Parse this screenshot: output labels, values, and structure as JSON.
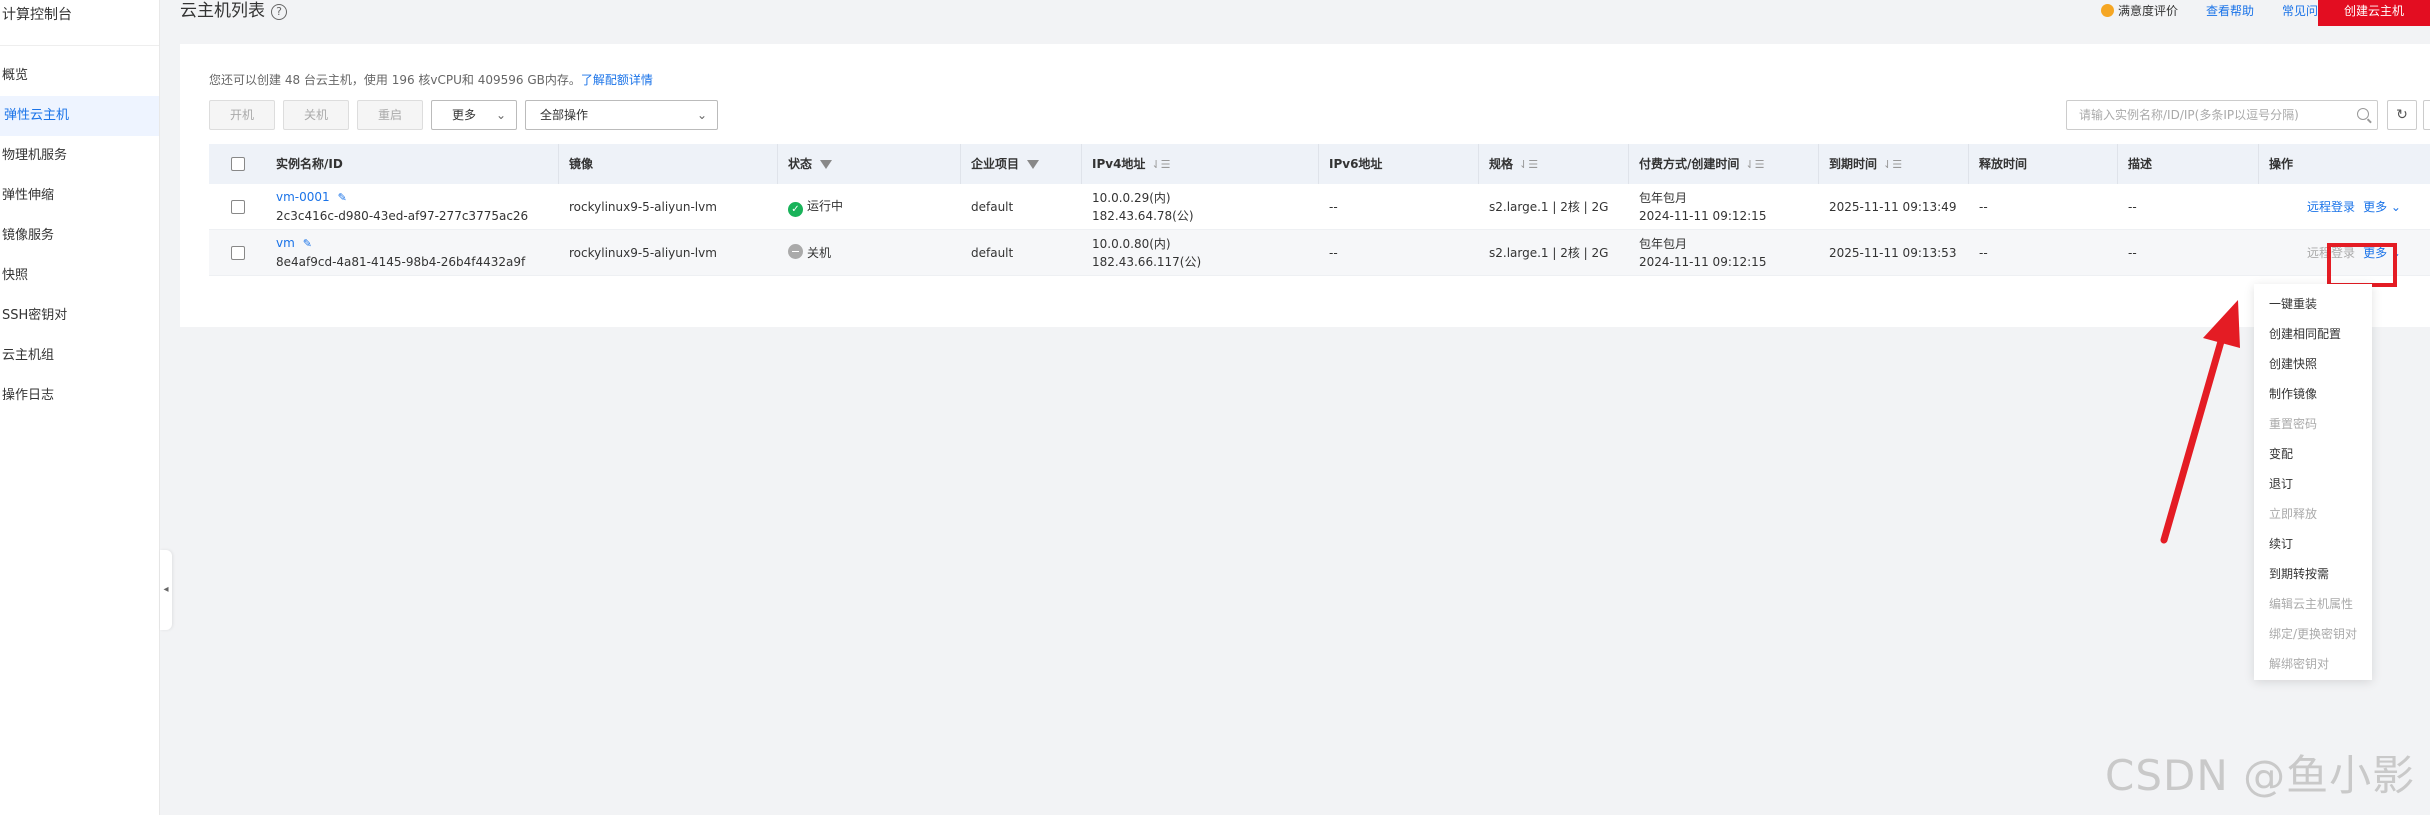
{
  "sidebar": {
    "title": "计算控制台",
    "items": [
      {
        "label": "概览"
      },
      {
        "label": "弹性云主机"
      },
      {
        "label": "物理机服务"
      },
      {
        "label": "弹性伸缩"
      },
      {
        "label": "镜像服务"
      },
      {
        "label": "快照"
      },
      {
        "label": "SSH密钥对"
      },
      {
        "label": "云主机组"
      },
      {
        "label": "操作日志"
      }
    ],
    "collapse_glyph": "◂"
  },
  "header": {
    "title": "云主机列表",
    "help_glyph": "?",
    "rating": "满意度评价",
    "help_link": "查看帮助",
    "faq_link": "常见问题",
    "create_button": "创建云主机"
  },
  "quota": {
    "text": "您还可以创建 48 台云主机，使用 196 核vCPU和 409596 GB内存。",
    "link": "了解配额详情"
  },
  "toolbar": {
    "start": "开机",
    "stop": "关机",
    "restart": "重启",
    "more": "更多",
    "all_ops": "全部操作",
    "chevron": "⌄"
  },
  "search": {
    "placeholder": "请输入实例名称/ID/IP(多条IP以逗号分隔)"
  },
  "icons": {
    "refresh": "↻",
    "export": "⇪",
    "sort": "⇃☰",
    "edit": "✎",
    "check": "✓"
  },
  "table": {
    "headers": {
      "name": "实例名称/ID",
      "image": "镜像",
      "status": "状态",
      "project": "企业项目",
      "ipv4": "IPv4地址",
      "ipv6": "IPv6地址",
      "spec": "规格",
      "pay": "付费方式/创建时间",
      "expire": "到期时间",
      "release": "释放时间",
      "desc": "描述",
      "ops": "操作"
    },
    "rows": [
      {
        "name": "vm-0001",
        "id": "2c3c416c-d980-43ed-af97-277c3775ac26",
        "image": "rockylinux9-5-aliyun-lvm",
        "status": "运行中",
        "project": "default",
        "ipv4_private": "10.0.0.29(内)",
        "ipv4_public": "182.43.64.78(公)",
        "ipv6": "--",
        "spec": "s2.large.1 | 2核 | 2G",
        "pay": "包年包月",
        "created": "2024-11-11 09:12:15",
        "expire": "2025-11-11 09:13:49",
        "release": "--",
        "desc": "--",
        "op_remote": "远程登录",
        "op_more": "更多 ⌄"
      },
      {
        "name": "vm",
        "id": "8e4af9cd-4a81-4145-98b4-26b4f4432a9f",
        "image": "rockylinux9-5-aliyun-lvm",
        "status": "关机",
        "project": "default",
        "ipv4_private": "10.0.0.80(内)",
        "ipv4_public": "182.43.66.117(公)",
        "ipv6": "--",
        "spec": "s2.large.1 | 2核 | 2G",
        "pay": "包年包月",
        "created": "2024-11-11 09:12:15",
        "expire": "2025-11-11 09:13:53",
        "release": "--",
        "desc": "--",
        "op_remote": "远程登录",
        "op_more": "更多 ⌄"
      }
    ]
  },
  "dropdown": {
    "items": [
      {
        "label": "一键重装",
        "enabled": true
      },
      {
        "label": "创建相同配置",
        "enabled": true
      },
      {
        "label": "创建快照",
        "enabled": true
      },
      {
        "label": "制作镜像",
        "enabled": true
      },
      {
        "label": "重置密码",
        "enabled": false
      },
      {
        "label": "变配",
        "enabled": true
      },
      {
        "label": "退订",
        "enabled": true
      },
      {
        "label": "立即释放",
        "enabled": false
      },
      {
        "label": "续订",
        "enabled": true
      },
      {
        "label": "到期转按需",
        "enabled": true
      },
      {
        "label": "编辑云主机属性",
        "enabled": false
      },
      {
        "label": "绑定/更换密钥对",
        "enabled": false
      },
      {
        "label": "解绑密钥对",
        "enabled": false
      }
    ]
  },
  "colors": {
    "accent": "#1a73e8",
    "brand_red": "#e30d21",
    "annotation_red": "#e41c24",
    "running_green": "#19b35a"
  },
  "watermark": "CSDN @鱼小影"
}
